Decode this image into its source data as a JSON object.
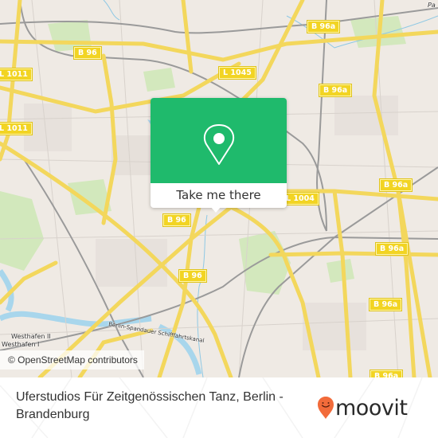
{
  "map": {
    "road_labels": [
      {
        "id": "b96-top",
        "text": "B 96"
      },
      {
        "id": "l1011-a",
        "text": "L 1011"
      },
      {
        "id": "l1011-b",
        "text": "L 1011"
      },
      {
        "id": "l1045",
        "text": "L 1045"
      },
      {
        "id": "b96a-1",
        "text": "B 96a"
      },
      {
        "id": "b96a-2",
        "text": "B 96a"
      },
      {
        "id": "b96a-3",
        "text": "B 96a"
      },
      {
        "id": "b96a-4",
        "text": "B 96a"
      },
      {
        "id": "b96a-5",
        "text": "B 96a"
      },
      {
        "id": "b96a-6",
        "text": "B 96a"
      },
      {
        "id": "l1004",
        "text": "L 1004"
      },
      {
        "id": "b96-mid",
        "text": "B 96"
      },
      {
        "id": "b96-low",
        "text": "B 96"
      }
    ],
    "place_labels": {
      "westhafen2": "Westhafen II",
      "westhafen1": "Westhafen I",
      "canal": "Berlin-Spandauer Schifffahrtskanal",
      "corner": "Pa"
    },
    "attribution": "© OpenStreetMap contributors"
  },
  "popup": {
    "icon": "location-pin-icon",
    "button_label": "Take me there",
    "accent_color": "#1fba6c"
  },
  "footer": {
    "title": "Uferstudios Für Zeitgenössischen Tanz, Berlin - Brandenburg",
    "logo_text": "moovit",
    "logo_color": "#f26b3a"
  }
}
